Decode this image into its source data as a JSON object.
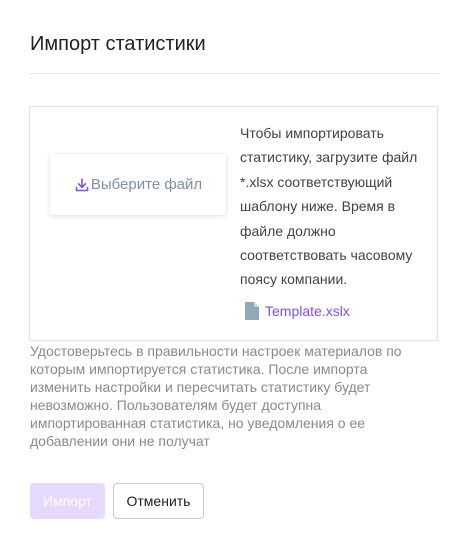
{
  "dialog": {
    "title": "Импорт статистики"
  },
  "upload": {
    "choose_file_label": "Выберите файл",
    "choose_file_icon": "download-icon",
    "instructions": "Чтобы импортировать статистику, загрузите файл *.xlsx соответствующий шаблону ниже. Время в файле должно соответствовать часовому поясу компании.",
    "template_link_label": "Template.xslx",
    "template_icon": "file-icon"
  },
  "warning_text": "Удостоверьтесь в правильности настроек материалов по которым импортируется статистика. После импорта изменить настройки и пересчитать статистику будет невозможно. Пользователям будет доступна импортированная статистика, но уведомления о ее добавлении они не получат",
  "buttons": {
    "import_label": "Импорт",
    "cancel_label": "Отменить"
  },
  "colors": {
    "accent": "#7c4dff",
    "import_disabled_bg": "#e5d9ff",
    "file_button_text": "#7e8fa8",
    "muted_text": "#8a8a8a"
  }
}
